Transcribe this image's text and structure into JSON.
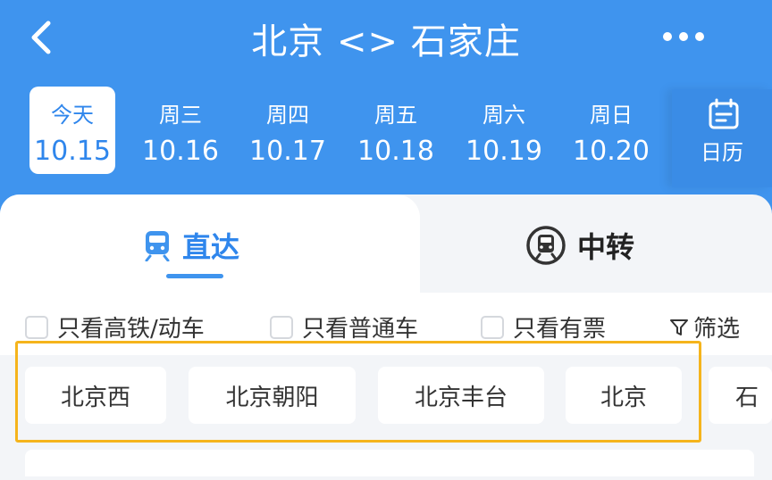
{
  "header": {
    "title": "北京 <> 石家庄",
    "back_icon": "chevron-left-icon",
    "more_icon": "more-horizontal-icon"
  },
  "dates": [
    {
      "weekday": "今天",
      "date": "10.15",
      "selected": true
    },
    {
      "weekday": "周三",
      "date": "10.16"
    },
    {
      "weekday": "周四",
      "date": "10.17"
    },
    {
      "weekday": "周五",
      "date": "10.18"
    },
    {
      "weekday": "周六",
      "date": "10.19"
    },
    {
      "weekday": "周日",
      "date": "10.20"
    }
  ],
  "calendar": {
    "label": "日历",
    "icon": "calendar-icon"
  },
  "tabs": {
    "direct": {
      "label": "直达",
      "icon": "train-icon",
      "active": true
    },
    "transfer": {
      "label": "中转",
      "icon": "transfer-train-icon"
    }
  },
  "filters": {
    "high_speed": "只看高铁/动车",
    "regular": "只看普通车",
    "available": "只看有票",
    "filter_button": "筛选"
  },
  "stations": [
    "北京西",
    "北京朝阳",
    "北京丰台",
    "北京",
    "石"
  ],
  "colors": {
    "primary": "#3f94ee",
    "highlight": "#f5b41c",
    "background": "#f3f5f8"
  }
}
